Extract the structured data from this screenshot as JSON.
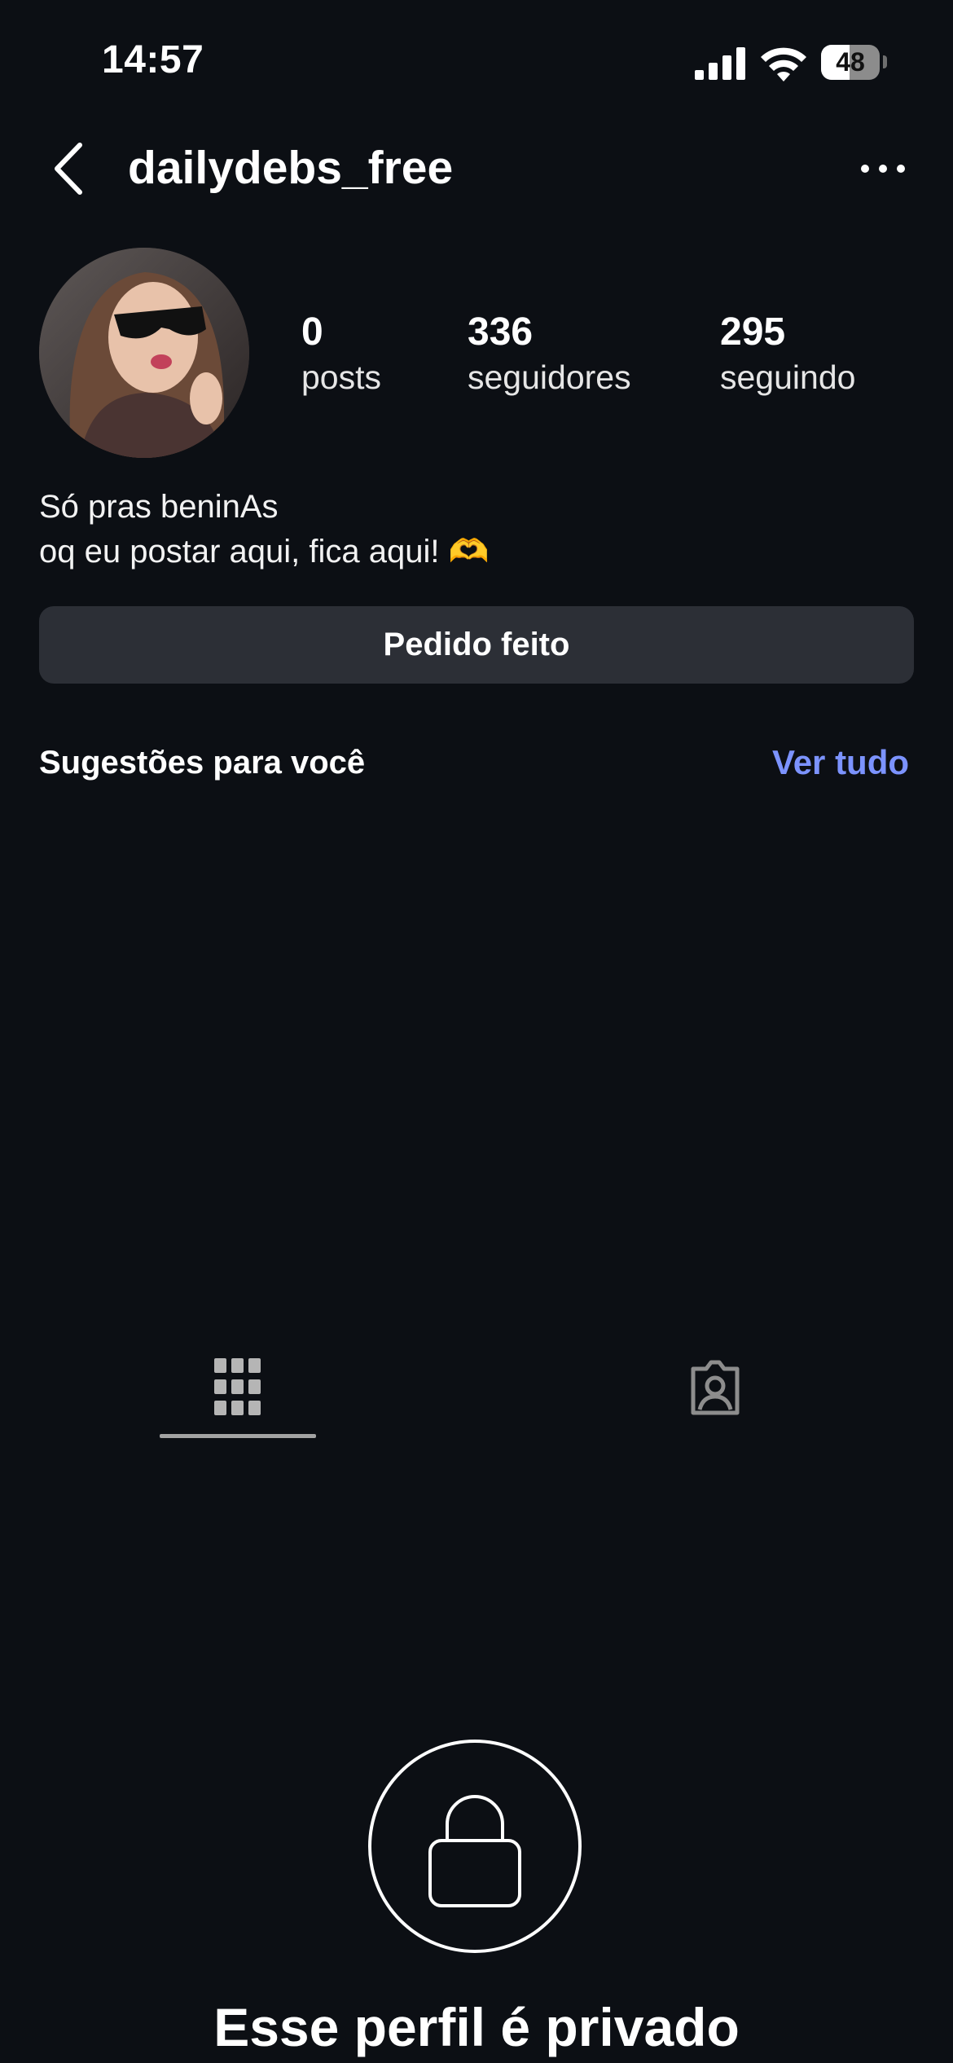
{
  "status_bar": {
    "time": "14:57",
    "battery_level": "48",
    "battery_fraction": 0.48,
    "icons": [
      "signal-icon",
      "wifi-icon",
      "battery-icon"
    ]
  },
  "header": {
    "username": "dailydebs_free",
    "back_icon": "chevron-left-icon",
    "more_icon": "more-horizontal-icon"
  },
  "profile": {
    "stats": [
      {
        "count": "0",
        "label": "posts"
      },
      {
        "count": "336",
        "label": "seguidores"
      },
      {
        "count": "295",
        "label": "seguindo"
      }
    ],
    "bio_line1": "Só pras beninAs",
    "bio_line2": "oq eu postar aqui, fica aqui! 🫶"
  },
  "actions": {
    "request_label": "Pedido feito"
  },
  "suggestions": {
    "title": "Sugestões para você",
    "see_all": "Ver tudo"
  },
  "tabs": [
    {
      "icon": "grid-icon",
      "active": true
    },
    {
      "icon": "tagged-icon",
      "active": false
    }
  ],
  "private_notice": {
    "icon": "lock-icon",
    "title": "Esse perfil é privado"
  },
  "colors": {
    "background": "#0c0f14",
    "button_bg": "#2c2f36",
    "link": "#7c93ff"
  }
}
